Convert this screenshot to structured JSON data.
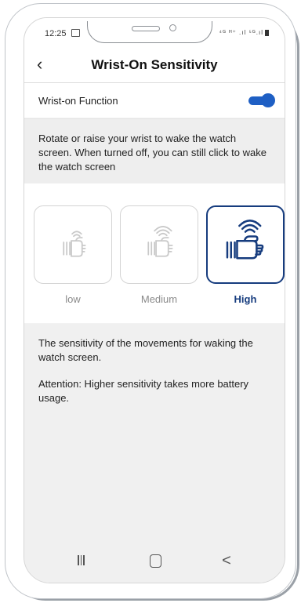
{
  "status_bar": {
    "time": "12:25",
    "right_icons": "⁴ᴳ ᴴ⁺ .ıl ⁵ᴳ.ıl",
    "icons": [
      "gallery-icon",
      "signal-icon",
      "battery-icon"
    ]
  },
  "header": {
    "title": "Wrist-On Sensitivity",
    "back_icon": "‹"
  },
  "wrist_on": {
    "label": "Wrist-on Function",
    "enabled": true
  },
  "description": "Rotate or raise your wrist to wake the watch screen. When turned off, you can still click to wake the watch screen",
  "sensitivity": {
    "options": [
      {
        "label": "low",
        "selected": false
      },
      {
        "label": "Medium",
        "selected": false
      },
      {
        "label": "High",
        "selected": true
      }
    ],
    "accent_color": "#163c7e"
  },
  "info": {
    "line1": "The sensitivity of the movements for waking the watch screen.",
    "line2": "Attention: Higher sensitivity takes more battery usage."
  },
  "nav": {
    "back_glyph": "<"
  },
  "colors": {
    "toggle": "#1e5fc4",
    "selected": "#163c7e",
    "muted": "#8a8a8a"
  }
}
